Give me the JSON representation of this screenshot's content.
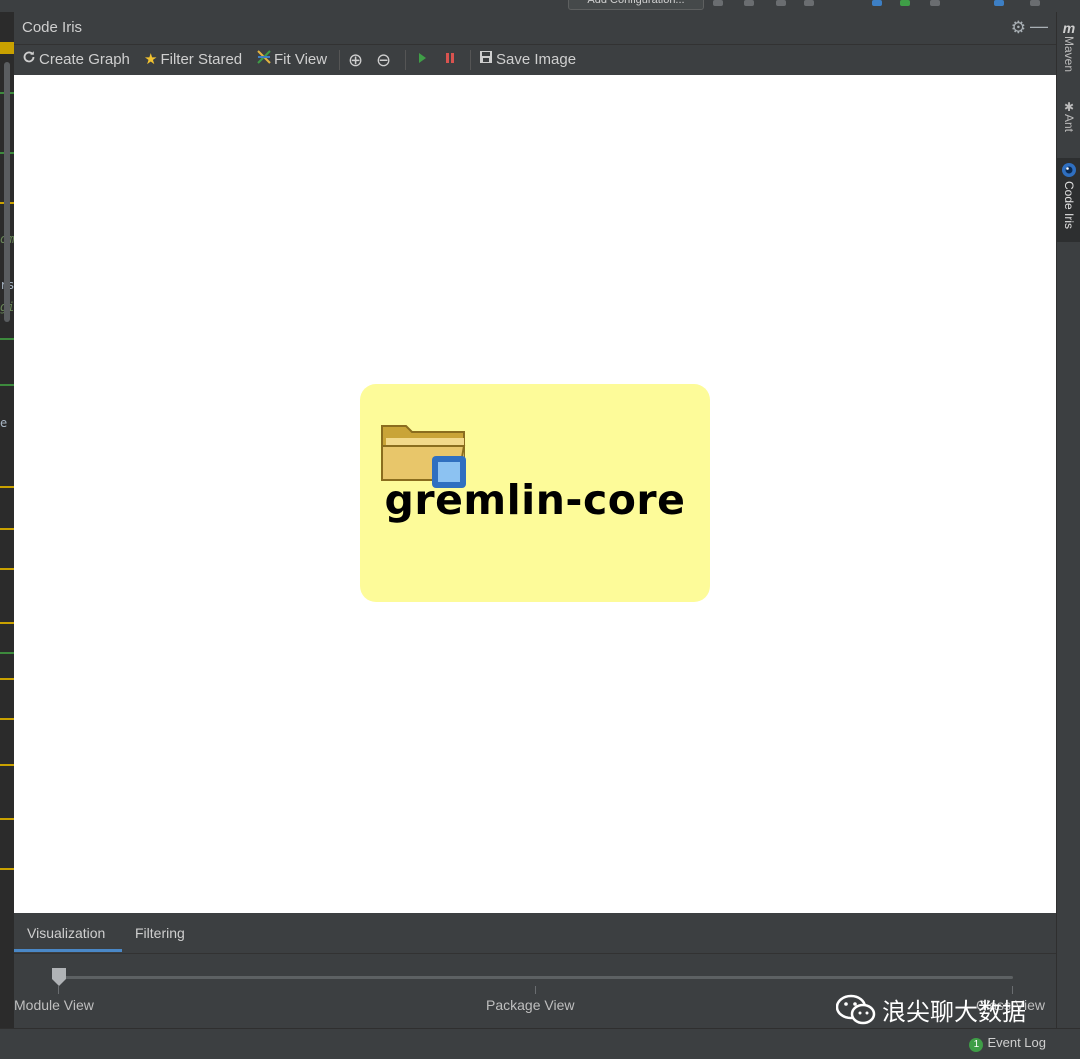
{
  "top_bar": {
    "run_config_label": "Add Configuration..."
  },
  "tool_window": {
    "title": "Code Iris",
    "gear_icon": "gear-icon",
    "minimize_icon": "minimize-icon"
  },
  "toolbar": {
    "create_graph_label": "Create Graph",
    "filter_stared_label": "Filter Stared",
    "fit_view_label": "Fit View",
    "save_image_label": "Save Image",
    "zoom_in_icon": "zoom-in-icon",
    "zoom_out_icon": "zoom-out-icon",
    "play_icon": "play-icon",
    "stop_icon": "stop-icon"
  },
  "graph": {
    "node": {
      "label": "gremlin-core",
      "icon": "module-folder-icon",
      "fill_color": "#fdfb99"
    }
  },
  "bottom_tabs": {
    "visualization_label": "Visualization",
    "filtering_label": "Filtering",
    "active": "Visualization"
  },
  "slider": {
    "module_label": "Module View",
    "package_label": "Package View",
    "class_label": "Class View",
    "selected": "Module View"
  },
  "status_bar": {
    "event_log_badge": "1",
    "event_log_label": "Event Log"
  },
  "right_strip": {
    "maven_label": "Maven",
    "ant_label": "Ant",
    "code_iris_label": "Code Iris"
  },
  "left_edge": {
    "frag_1": "om",
    "frag_2": "rs",
    "frag_3": "gi",
    "frag_4": "e"
  },
  "watermark": {
    "text": "浪尖聊大数据"
  },
  "colors": {
    "accent": "#4a88c7",
    "background": "#3c3f41",
    "canvas": "#ffffff"
  }
}
